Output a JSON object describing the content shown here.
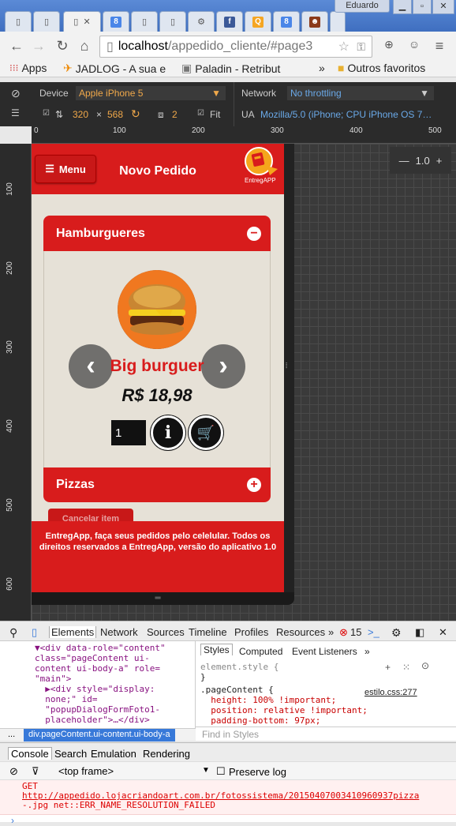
{
  "browser": {
    "user_badge": "Eduardo",
    "url_host": "localhost",
    "url_path": "/appedido_cliente/#page3",
    "bookmarks": {
      "apps": "Apps",
      "jadlog": "JADLOG - A sua e",
      "paladin": "Paladin - Retribut",
      "more": "»",
      "others": "Outros favoritos"
    },
    "tab_icon_labels": [
      "8",
      "8"
    ]
  },
  "devbar": {
    "device_label": "Device",
    "device_value": "Apple iPhone 5",
    "network_label": "Network",
    "network_value": "No throttling",
    "width": "320",
    "times": "×",
    "height": "568",
    "dpr": "2",
    "fit_label": "Fit",
    "ua_label": "UA",
    "ua_value": "Mozilla/5.0 (iPhone; CPU iPhone OS 7…"
  },
  "ruler": {
    "top": [
      "0",
      "100",
      "200",
      "300",
      "400",
      "500"
    ],
    "left": [
      "100",
      "200",
      "300",
      "400",
      "500",
      "600"
    ]
  },
  "zoom": {
    "minus": "—",
    "value": "1.0",
    "plus": "+"
  },
  "app": {
    "menu_label": "Menu",
    "title": "Novo Pedido",
    "logo_text": "EntregAPP",
    "sections": [
      {
        "label": "Hamburgueres",
        "icon": "−"
      },
      {
        "label": "Pizzas",
        "icon": "+"
      }
    ],
    "product": {
      "name": "Big burguer",
      "price": "R$ 18,98",
      "quantity": "1"
    },
    "prev_arrow": "‹",
    "next_arrow": "›",
    "cancel_label": "Cancelar item",
    "footer_text": "EntregApp, faça seus pedidos pelo celelular. Todos os direitos reservados a EntregApp, versão do aplicativo 1.0"
  },
  "devtools": {
    "tabs": [
      "Elements",
      "Network",
      "Sources",
      "Timeline",
      "Profiles",
      "Resources"
    ],
    "more": "»",
    "error_count": "15",
    "dom_lines": [
      "▼<div data-role=\"content\"",
      "class=\"pageContent ui-",
      "content ui-body-a\" role=",
      "\"main\">",
      "  ▶<div style=\"display:",
      "  none;\" id=",
      "  \"popupDialogFormFoto1-",
      "  placeholder\">…</div>"
    ],
    "breadcrumb_dots": "...",
    "breadcrumb": "div.pageContent.ui-content.ui-body-a",
    "style_tabs": [
      "Styles",
      "Computed",
      "Event Listeners"
    ],
    "style_more": "»",
    "style_lines": [
      "element.style {",
      "}",
      ".pageContent {",
      "  height: 100% !important;",
      "  position: relative !important;",
      "  padding-bottom: 97px;"
    ],
    "stylesheet_link": "estilo.css:277",
    "find_placeholder": "Find in Styles",
    "drawer_tabs": [
      "Console",
      "Search",
      "Emulation",
      "Rendering"
    ],
    "frame": "<top frame>",
    "preserve_log": "Preserve log",
    "error_lines": [
      "GET",
      "http://appedido.lojacriandoart.com.br/fotossistema/20150407003410960937pizza",
      "-.jpg net::ERR_NAME_RESOLUTION_FAILED"
    ],
    "prompt": "›"
  }
}
